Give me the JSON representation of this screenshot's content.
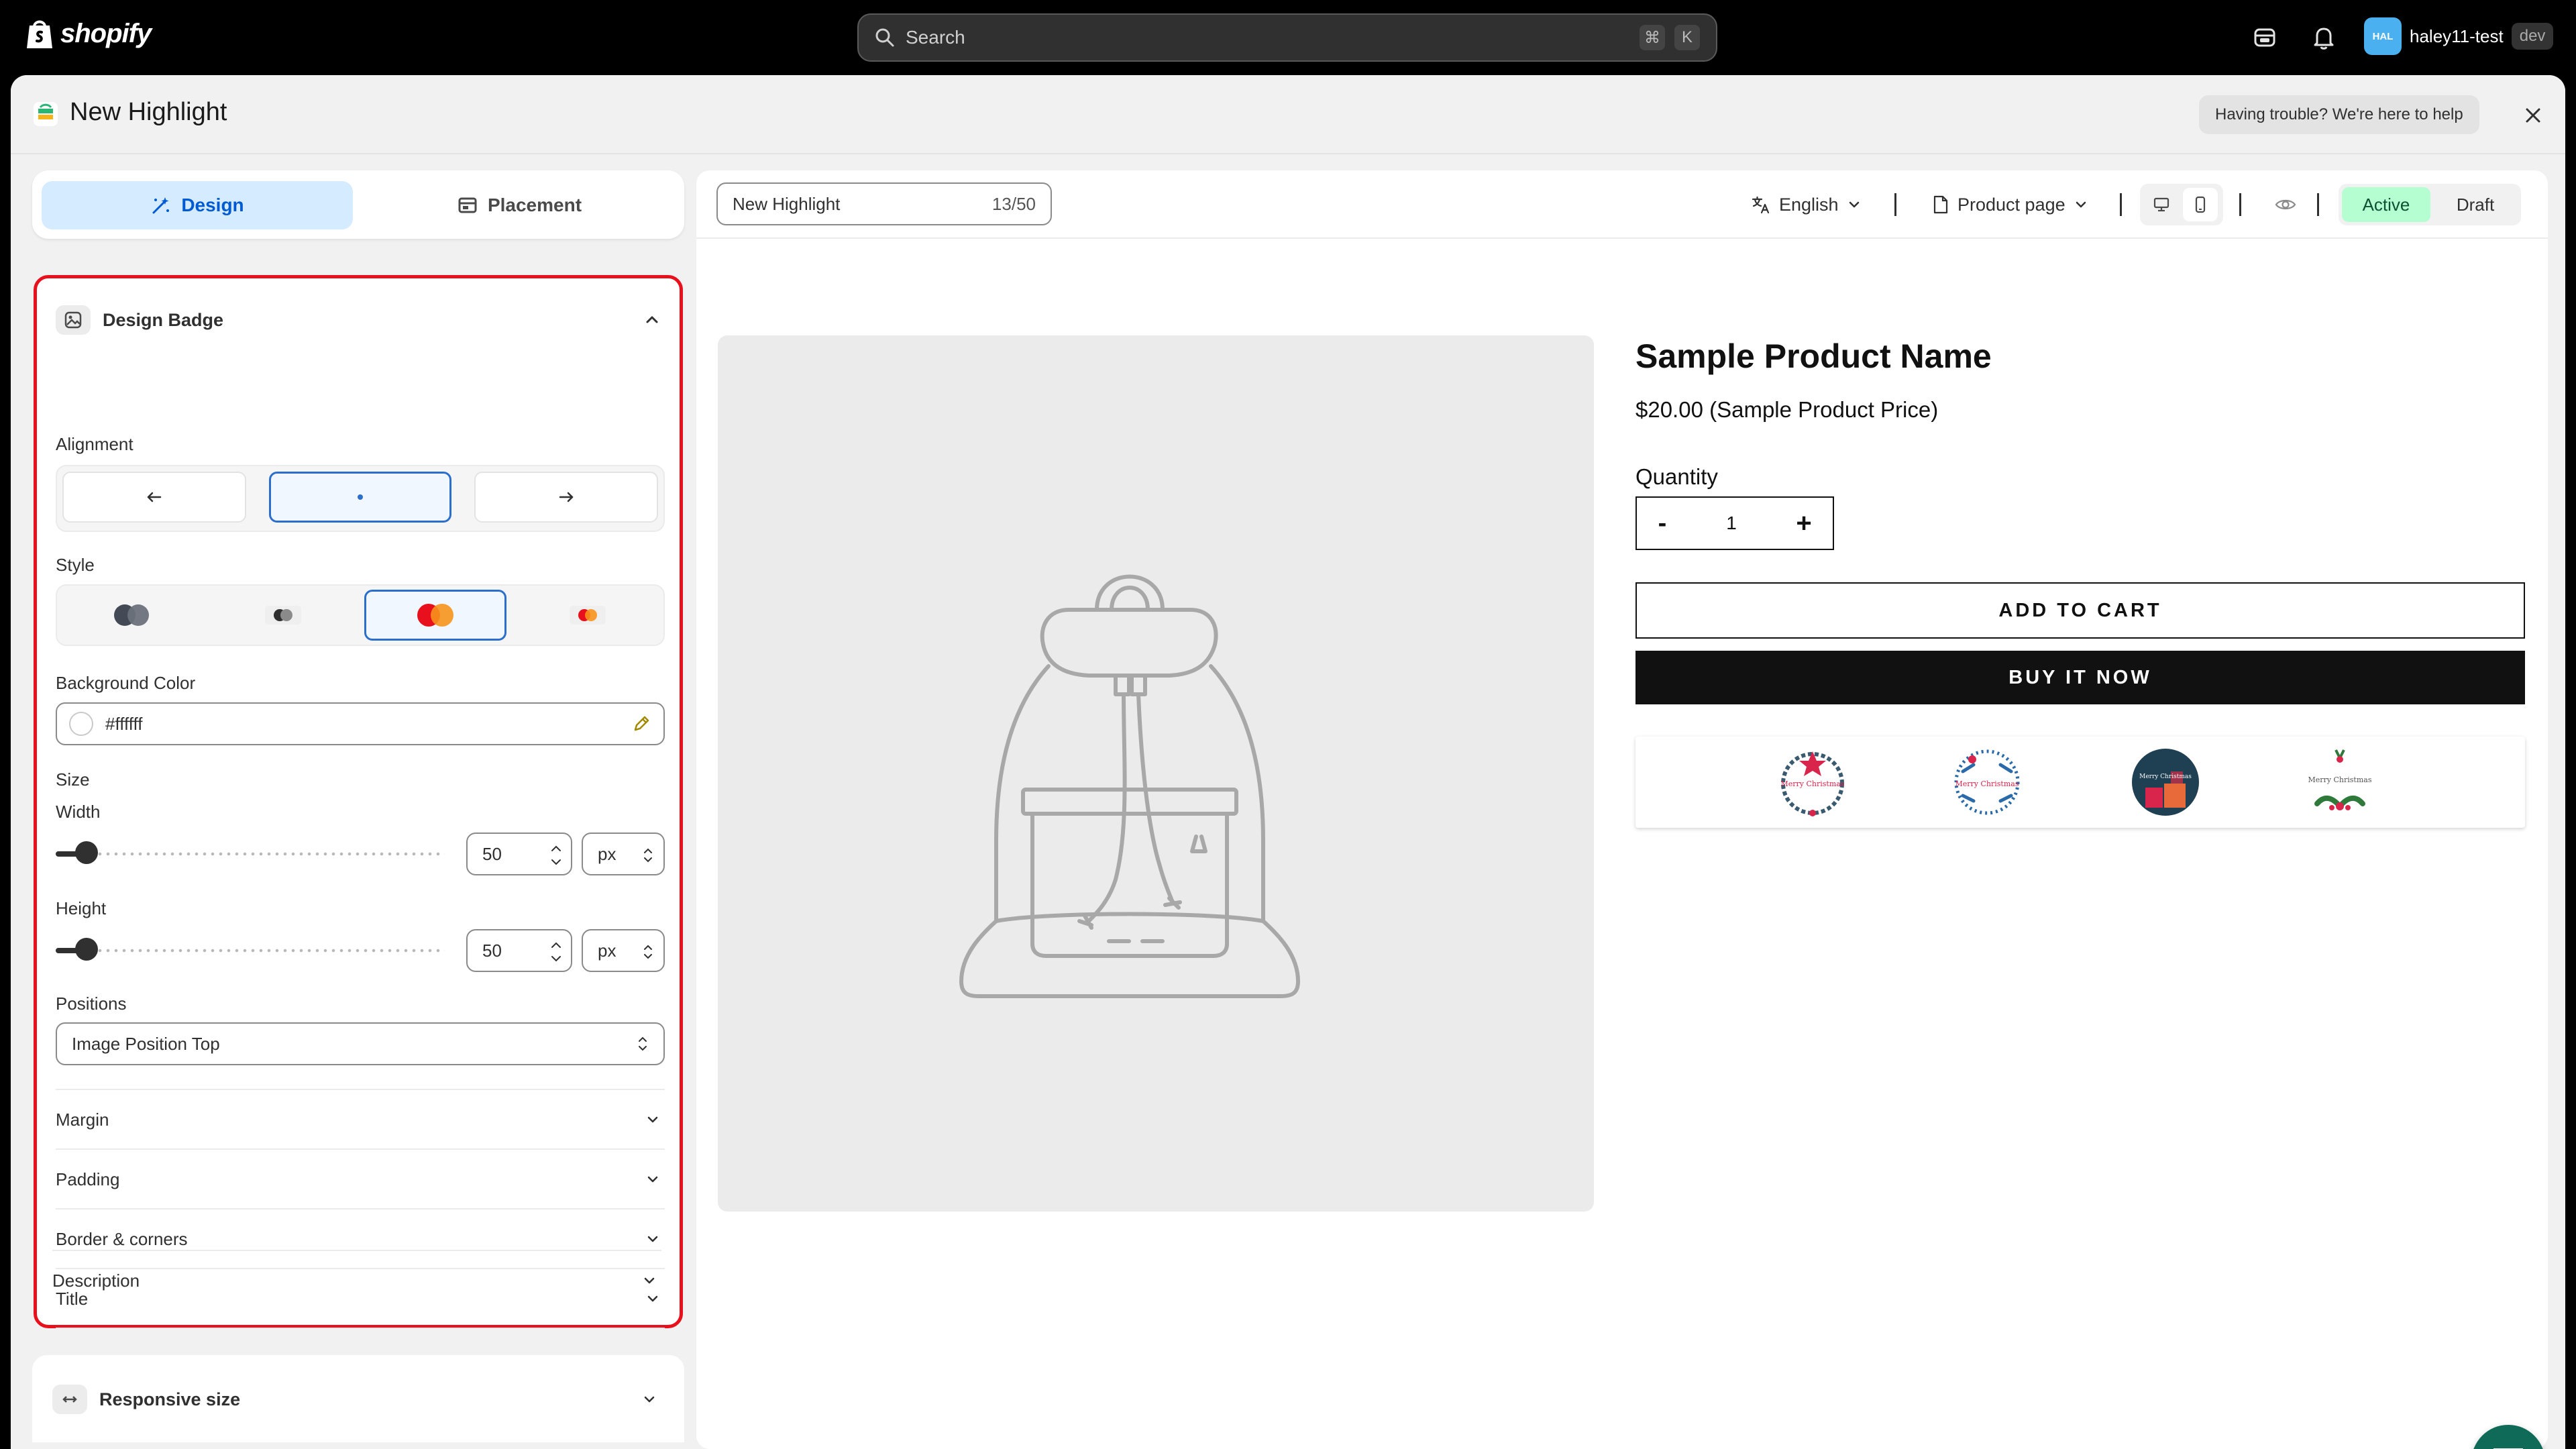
{
  "topbar": {
    "brand": "shopify",
    "search_placeholder": "Search",
    "shortcut_keys": [
      "⌘",
      "K"
    ],
    "user_initials": "HAL",
    "user_name": "haley11-test",
    "user_badge": "dev"
  },
  "title_bar": {
    "title": "New Highlight",
    "help": "Having trouble? We're here to help"
  },
  "tabs": [
    {
      "label": "Design",
      "icon": "magic-wand-icon",
      "active": true
    },
    {
      "label": "Placement",
      "icon": "layout-icon",
      "active": false
    }
  ],
  "design_panel": {
    "title": "Design Badge",
    "alignment_label": "Alignment",
    "alignment_options": [
      "left",
      "center",
      "right"
    ],
    "alignment_selected": "center",
    "style_label": "Style",
    "style_selected": 3,
    "bg_color_label": "Background Color",
    "bg_color_value": "#ffffff",
    "size_label": "Size",
    "width_label": "Width",
    "width_value": "50",
    "width_unit": "px",
    "width_slider_fraction": 0.05,
    "height_label": "Height",
    "height_value": "50",
    "height_unit": "px",
    "height_slider_fraction": 0.05,
    "positions_label": "Positions",
    "positions_value": "Image Position Top",
    "sections": [
      "Margin",
      "Padding",
      "Border & corners",
      "Title",
      "Description"
    ]
  },
  "responsive": {
    "title": "Responsive size"
  },
  "preview": {
    "name_value": "New Highlight",
    "name_count": "13/50",
    "language": "English",
    "page_type": "Product page",
    "status_active": "Active",
    "status_draft": "Draft",
    "product_name": "Sample Product Name",
    "product_price": "$20.00 (Sample Product Price)",
    "quantity_label": "Quantity",
    "qty_minus": "-",
    "qty_value": "1",
    "qty_plus": "+",
    "add_to_cart": "ADD TO CART",
    "buy_now": "BUY IT NOW",
    "badges": [
      "Merry Christmas",
      "Merry Christmas",
      "Merry Christmas",
      "Merry Christmas"
    ]
  },
  "colors": {
    "accent": "#005bd3",
    "selected_border": "#2c6ecb",
    "highlight_border": "#e8101c",
    "active_status_bg": "#b4fed2",
    "chat_fab": "#0f6b57"
  }
}
